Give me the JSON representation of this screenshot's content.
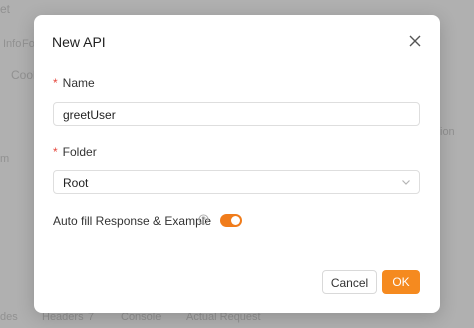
{
  "background": {
    "fragment_et": "et",
    "fragment_info": "Info",
    "fragment_fo": "Fo",
    "fragment_cool": "Cool",
    "fragment_ion": "ion",
    "fragment_m": "m",
    "fragment_des": "des",
    "fragment_headers": "Headers",
    "fragment_headers_count": "7",
    "fragment_console": "Console",
    "fragment_actual_request": "Actual Request"
  },
  "modal": {
    "title": "New API",
    "name": {
      "label": "Name",
      "value": "greetUser"
    },
    "folder": {
      "label": "Folder",
      "value": "Root"
    },
    "auto_fill": {
      "label": "Auto fill Response & Example",
      "enabled": true
    },
    "buttons": {
      "cancel": "Cancel",
      "ok": "OK"
    }
  },
  "colors": {
    "accent": "#f58a1f",
    "required": "#e5483e"
  },
  "icons": [
    "close-icon",
    "chevron-down-icon",
    "help-icon"
  ]
}
